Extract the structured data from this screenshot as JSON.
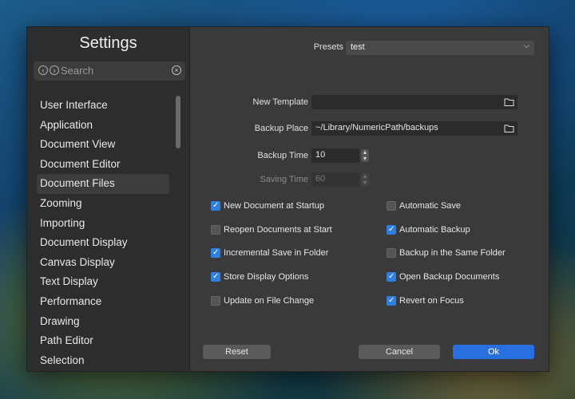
{
  "sidebar": {
    "title": "Settings",
    "search_placeholder": "Search",
    "items": [
      {
        "label": "User Interface"
      },
      {
        "label": "Application"
      },
      {
        "label": "Document View"
      },
      {
        "label": "Document Editor"
      },
      {
        "label": "Document Files"
      },
      {
        "label": "Zooming"
      },
      {
        "label": "Importing"
      },
      {
        "label": "Document Display"
      },
      {
        "label": "Canvas Display"
      },
      {
        "label": "Text Display"
      },
      {
        "label": "Performance"
      },
      {
        "label": "Drawing"
      },
      {
        "label": "Path Editor"
      },
      {
        "label": "Selection"
      }
    ],
    "selected_index": 4
  },
  "presets": {
    "label": "Presets",
    "value": "test"
  },
  "fields": {
    "new_template": {
      "label": "New Template",
      "value": ""
    },
    "backup_place": {
      "label": "Backup Place",
      "value": "~/Library/NumericPath/backups"
    },
    "backup_time": {
      "label": "Backup Time",
      "value": "10"
    },
    "saving_time": {
      "label": "Saving Time",
      "value": "60"
    }
  },
  "checkboxes_left": [
    {
      "label": "New Document at Startup",
      "checked": true
    },
    {
      "label": "Reopen Documents at Start",
      "checked": false
    },
    {
      "label": "Incremental Save in Folder",
      "checked": true
    },
    {
      "label": "Store Display Options",
      "checked": true
    },
    {
      "label": "Update on File Change",
      "checked": false
    }
  ],
  "checkboxes_right": [
    {
      "label": "Automatic Save",
      "checked": false
    },
    {
      "label": "Automatic Backup",
      "checked": true
    },
    {
      "label": "Backup in the Same Folder",
      "checked": false
    },
    {
      "label": "Open Backup Documents",
      "checked": true
    },
    {
      "label": "Revert on Focus",
      "checked": true
    }
  ],
  "buttons": {
    "reset": "Reset",
    "cancel": "Cancel",
    "ok": "Ok"
  },
  "colors": {
    "accent": "#2a6fe0"
  }
}
